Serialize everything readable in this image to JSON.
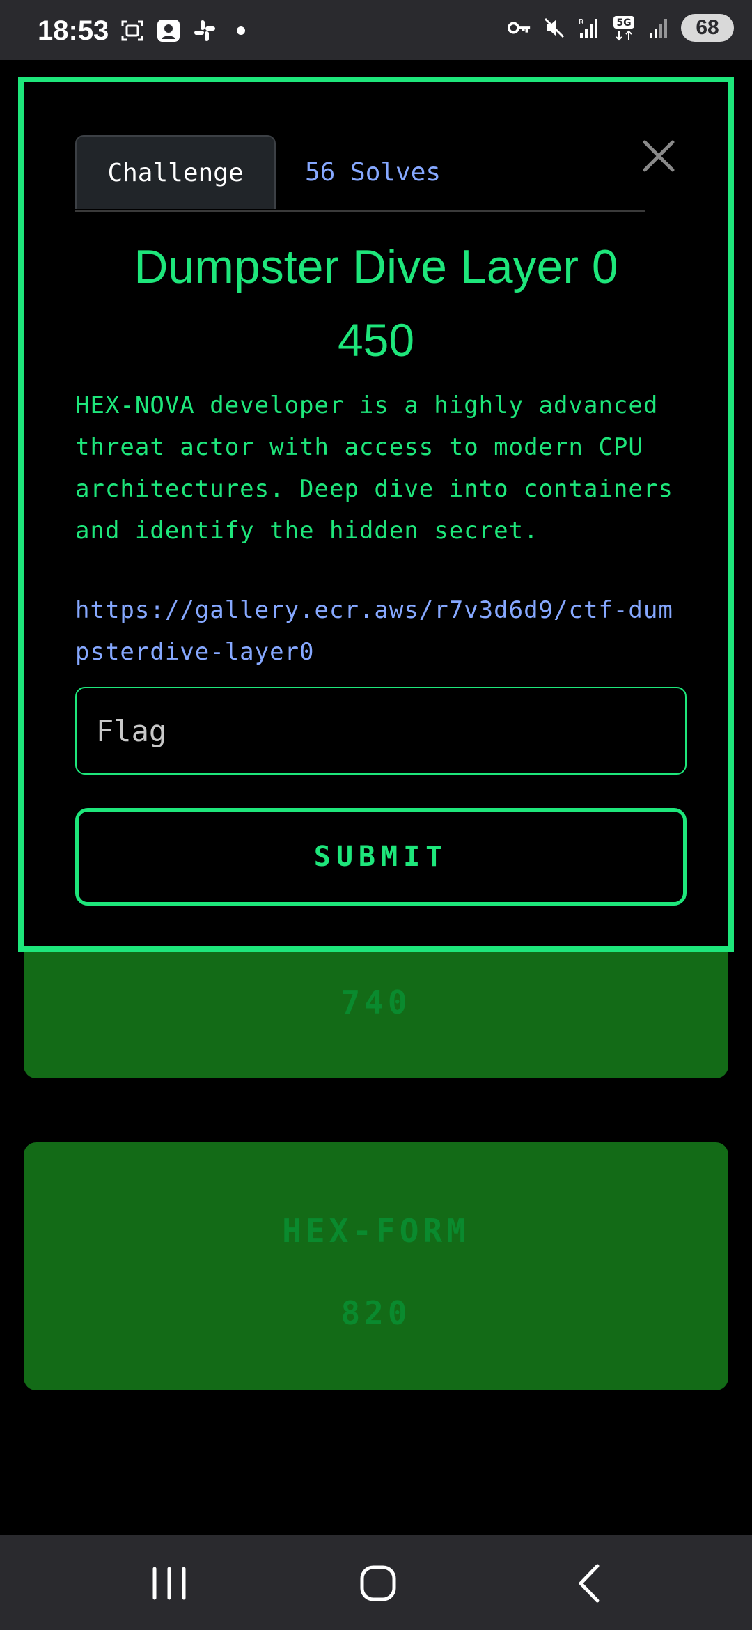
{
  "status_bar": {
    "time": "18:53",
    "battery": "68",
    "network": "5G",
    "left_icons": [
      "screenshot-icon",
      "assistant-icon",
      "slack-icon",
      "dot-icon"
    ],
    "right_icons": [
      "vpn-key-icon",
      "mute-icon",
      "signal-r-icon",
      "5g-data-icon",
      "signal-icon",
      "battery-icon"
    ]
  },
  "modal": {
    "tabs": [
      {
        "label": "Challenge",
        "active": true
      },
      {
        "label": "56 Solves",
        "active": false
      }
    ],
    "title": "Dumpster Dive Layer 0",
    "points": "450",
    "description": "HEX-NOVA developer is a highly advanced threat actor with access to modern CPU architectures. Deep dive into containers and identify the hidden secret.",
    "link": "https://gallery.ecr.aws/r7v3d6d9/ctf-dumpsterdive-layer0",
    "flag_placeholder": "Flag",
    "flag_value": "",
    "submit_label": "SUBMIT"
  },
  "background_cards": [
    {
      "name": "",
      "value": "740"
    },
    {
      "name": "HEX-FORM",
      "value": "820"
    }
  ],
  "colors": {
    "accent": "#1ee67b",
    "link": "#86a8ff",
    "card_bg": "#136b17",
    "card_text": "#0a8a2e",
    "system_bar": "#2a2a2e"
  },
  "nav_bar": {
    "buttons": [
      "recents-icon",
      "home-icon",
      "back-icon"
    ]
  }
}
